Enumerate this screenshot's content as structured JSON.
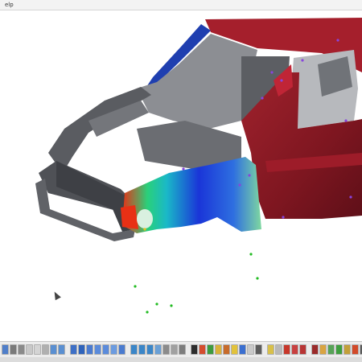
{
  "menubar": {
    "help_label": "elp"
  },
  "viewport": {
    "model_icon": "car-body-fem-model-icon",
    "colors": {
      "body_red": "#8b1a24",
      "frame_gray": "#5f6166",
      "pillar_blue": "#1f3fb0",
      "node_green": "#22bb22",
      "node_purple": "#8844dd",
      "contour_low": "#1a35d8",
      "contour_mid": "#2ad07a",
      "contour_high": "#e83015"
    }
  },
  "toolbar": {
    "buttons": [
      {
        "icon": "open-icon",
        "color": "#4f7ec9"
      },
      {
        "icon": "save-icon",
        "color": "#7a7a7a"
      },
      {
        "icon": "print-icon",
        "color": "#8a8a8a"
      },
      {
        "icon": "cut-icon",
        "color": "#c8c8c8"
      },
      {
        "icon": "copy-icon",
        "color": "#d4d4d4"
      },
      {
        "icon": "paste-icon",
        "color": "#b0b0b0"
      },
      {
        "icon": "undo-icon",
        "color": "#5a8fd1"
      },
      {
        "icon": "redo-icon",
        "color": "#5a8fd1"
      },
      {
        "icon": "select-icon",
        "color": "#3d6fc6"
      },
      {
        "icon": "rotate-icon",
        "color": "#2f63bb"
      },
      {
        "icon": "pan-icon",
        "color": "#4b7bd0"
      },
      {
        "icon": "zoom-in-icon",
        "color": "#5b8bdb"
      },
      {
        "icon": "zoom-out-icon",
        "color": "#5b8bdb"
      },
      {
        "icon": "zoom-fit-icon",
        "color": "#6b9be0"
      },
      {
        "icon": "zoom-window-icon",
        "color": "#4a7bcf"
      },
      {
        "icon": "front-view-icon",
        "color": "#3b86c8"
      },
      {
        "icon": "side-view-icon",
        "color": "#3b86c8"
      },
      {
        "icon": "top-view-icon",
        "color": "#3b86c8"
      },
      {
        "icon": "iso-view-icon",
        "color": "#6aa0d6"
      },
      {
        "icon": "shaded-icon",
        "color": "#8b8b8b"
      },
      {
        "icon": "wireframe-icon",
        "color": "#a0a0a0"
      },
      {
        "icon": "hidden-line-icon",
        "color": "#7d7d7d"
      },
      {
        "icon": "mesh-icon",
        "color": "#2d2d2d"
      },
      {
        "icon": "contour-icon",
        "color": "#d44c2e"
      },
      {
        "icon": "vector-icon",
        "color": "#3e9b3e"
      },
      {
        "icon": "deform-icon",
        "color": "#d9b23a"
      },
      {
        "icon": "animate-icon",
        "color": "#c76b2b"
      },
      {
        "icon": "light-icon",
        "color": "#e2c23a"
      },
      {
        "icon": "material-icon",
        "color": "#3b6fd0"
      },
      {
        "icon": "section-icon",
        "color": "#c9c9c9"
      },
      {
        "icon": "probe-icon",
        "color": "#5c5c5c"
      },
      {
        "icon": "annotate-icon",
        "color": "#d8c04a"
      },
      {
        "icon": "measure-icon",
        "color": "#b8b8b8"
      },
      {
        "icon": "node-icon",
        "color": "#c7372b"
      },
      {
        "icon": "element-icon",
        "color": "#c84040"
      },
      {
        "icon": "group-icon",
        "color": "#b83535"
      },
      {
        "icon": "filter-icon",
        "color": "#9a2a2a"
      },
      {
        "icon": "pencil-icon",
        "color": "#d9a441"
      },
      {
        "icon": "edit-icon",
        "color": "#57a357"
      },
      {
        "icon": "check-icon",
        "color": "#3f9f3f"
      },
      {
        "icon": "table-icon",
        "color": "#c3a03a"
      },
      {
        "icon": "chart-icon",
        "color": "#d24a2a"
      },
      {
        "icon": "report-icon",
        "color": "#5a5a5a"
      },
      {
        "icon": "settings-icon",
        "color": "#4a4a4a"
      }
    ]
  }
}
